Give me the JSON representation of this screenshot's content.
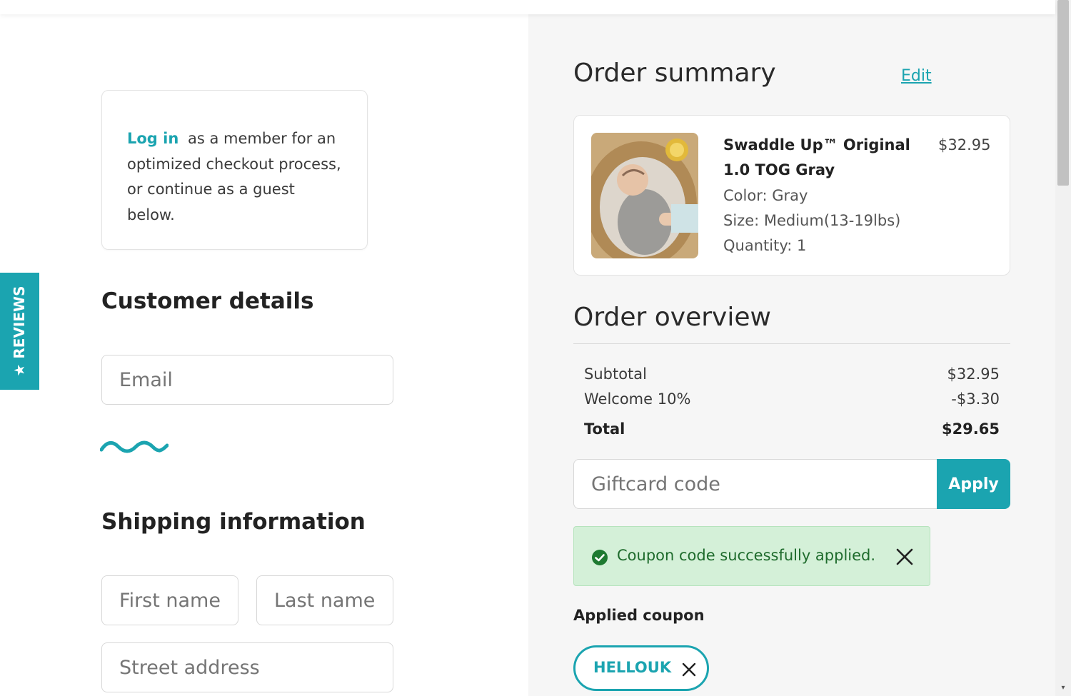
{
  "reviews_tab": {
    "label": "★ REVIEWS"
  },
  "login_prompt": {
    "link_label": "Log in",
    "text": "as a member for an optimized checkout process, or continue as a guest below."
  },
  "customer_details": {
    "title": "Customer details",
    "email_placeholder": "Email"
  },
  "shipping_info": {
    "title": "Shipping information",
    "first_name_placeholder": "First name",
    "last_name_placeholder": "Last name",
    "street_placeholder": "Street address"
  },
  "order_summary": {
    "title": "Order summary",
    "edit_label": "Edit",
    "product": {
      "name": "Swaddle Up™ Original 1.0 TOG Gray",
      "price": "$32.95",
      "color": "Color: Gray",
      "size": "Size: Medium(13-19lbs)",
      "quantity": "Quantity: 1"
    }
  },
  "order_overview": {
    "title": "Order overview",
    "rows": [
      {
        "label": "Subtotal",
        "value": "$32.95"
      },
      {
        "label": "Welcome 10%",
        "value": "-$3.30"
      },
      {
        "label": "Total",
        "value": "$29.65"
      }
    ]
  },
  "giftcard": {
    "placeholder": "Giftcard code",
    "apply_label": "Apply"
  },
  "coupon_alert": {
    "message": "Coupon code successfully applied."
  },
  "applied_coupon": {
    "label": "Applied coupon",
    "code": "HELLOUK"
  },
  "colors": {
    "accent": "#1ba4b0",
    "success_bg": "#d4f0d8",
    "success_text": "#1e6b2c",
    "summary_bg": "#f6f6f6"
  }
}
